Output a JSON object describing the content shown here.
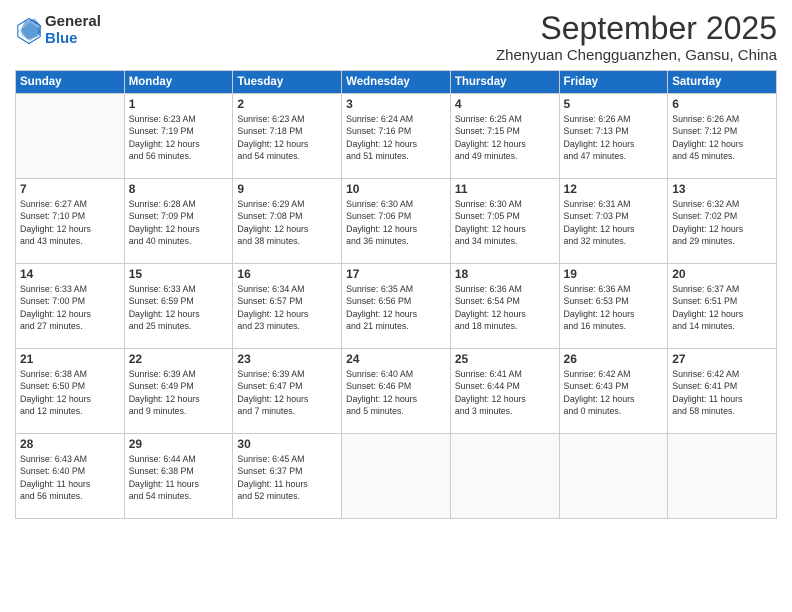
{
  "logo": {
    "general": "General",
    "blue": "Blue"
  },
  "title": "September 2025",
  "location": "Zhenyuan Chengguanzhen, Gansu, China",
  "days_of_week": [
    "Sunday",
    "Monday",
    "Tuesday",
    "Wednesday",
    "Thursday",
    "Friday",
    "Saturday"
  ],
  "weeks": [
    [
      {
        "day": "",
        "info": ""
      },
      {
        "day": "1",
        "info": "Sunrise: 6:23 AM\nSunset: 7:19 PM\nDaylight: 12 hours\nand 56 minutes."
      },
      {
        "day": "2",
        "info": "Sunrise: 6:23 AM\nSunset: 7:18 PM\nDaylight: 12 hours\nand 54 minutes."
      },
      {
        "day": "3",
        "info": "Sunrise: 6:24 AM\nSunset: 7:16 PM\nDaylight: 12 hours\nand 51 minutes."
      },
      {
        "day": "4",
        "info": "Sunrise: 6:25 AM\nSunset: 7:15 PM\nDaylight: 12 hours\nand 49 minutes."
      },
      {
        "day": "5",
        "info": "Sunrise: 6:26 AM\nSunset: 7:13 PM\nDaylight: 12 hours\nand 47 minutes."
      },
      {
        "day": "6",
        "info": "Sunrise: 6:26 AM\nSunset: 7:12 PM\nDaylight: 12 hours\nand 45 minutes."
      }
    ],
    [
      {
        "day": "7",
        "info": "Sunrise: 6:27 AM\nSunset: 7:10 PM\nDaylight: 12 hours\nand 43 minutes."
      },
      {
        "day": "8",
        "info": "Sunrise: 6:28 AM\nSunset: 7:09 PM\nDaylight: 12 hours\nand 40 minutes."
      },
      {
        "day": "9",
        "info": "Sunrise: 6:29 AM\nSunset: 7:08 PM\nDaylight: 12 hours\nand 38 minutes."
      },
      {
        "day": "10",
        "info": "Sunrise: 6:30 AM\nSunset: 7:06 PM\nDaylight: 12 hours\nand 36 minutes."
      },
      {
        "day": "11",
        "info": "Sunrise: 6:30 AM\nSunset: 7:05 PM\nDaylight: 12 hours\nand 34 minutes."
      },
      {
        "day": "12",
        "info": "Sunrise: 6:31 AM\nSunset: 7:03 PM\nDaylight: 12 hours\nand 32 minutes."
      },
      {
        "day": "13",
        "info": "Sunrise: 6:32 AM\nSunset: 7:02 PM\nDaylight: 12 hours\nand 29 minutes."
      }
    ],
    [
      {
        "day": "14",
        "info": "Sunrise: 6:33 AM\nSunset: 7:00 PM\nDaylight: 12 hours\nand 27 minutes."
      },
      {
        "day": "15",
        "info": "Sunrise: 6:33 AM\nSunset: 6:59 PM\nDaylight: 12 hours\nand 25 minutes."
      },
      {
        "day": "16",
        "info": "Sunrise: 6:34 AM\nSunset: 6:57 PM\nDaylight: 12 hours\nand 23 minutes."
      },
      {
        "day": "17",
        "info": "Sunrise: 6:35 AM\nSunset: 6:56 PM\nDaylight: 12 hours\nand 21 minutes."
      },
      {
        "day": "18",
        "info": "Sunrise: 6:36 AM\nSunset: 6:54 PM\nDaylight: 12 hours\nand 18 minutes."
      },
      {
        "day": "19",
        "info": "Sunrise: 6:36 AM\nSunset: 6:53 PM\nDaylight: 12 hours\nand 16 minutes."
      },
      {
        "day": "20",
        "info": "Sunrise: 6:37 AM\nSunset: 6:51 PM\nDaylight: 12 hours\nand 14 minutes."
      }
    ],
    [
      {
        "day": "21",
        "info": "Sunrise: 6:38 AM\nSunset: 6:50 PM\nDaylight: 12 hours\nand 12 minutes."
      },
      {
        "day": "22",
        "info": "Sunrise: 6:39 AM\nSunset: 6:49 PM\nDaylight: 12 hours\nand 9 minutes."
      },
      {
        "day": "23",
        "info": "Sunrise: 6:39 AM\nSunset: 6:47 PM\nDaylight: 12 hours\nand 7 minutes."
      },
      {
        "day": "24",
        "info": "Sunrise: 6:40 AM\nSunset: 6:46 PM\nDaylight: 12 hours\nand 5 minutes."
      },
      {
        "day": "25",
        "info": "Sunrise: 6:41 AM\nSunset: 6:44 PM\nDaylight: 12 hours\nand 3 minutes."
      },
      {
        "day": "26",
        "info": "Sunrise: 6:42 AM\nSunset: 6:43 PM\nDaylight: 12 hours\nand 0 minutes."
      },
      {
        "day": "27",
        "info": "Sunrise: 6:42 AM\nSunset: 6:41 PM\nDaylight: 11 hours\nand 58 minutes."
      }
    ],
    [
      {
        "day": "28",
        "info": "Sunrise: 6:43 AM\nSunset: 6:40 PM\nDaylight: 11 hours\nand 56 minutes."
      },
      {
        "day": "29",
        "info": "Sunrise: 6:44 AM\nSunset: 6:38 PM\nDaylight: 11 hours\nand 54 minutes."
      },
      {
        "day": "30",
        "info": "Sunrise: 6:45 AM\nSunset: 6:37 PM\nDaylight: 11 hours\nand 52 minutes."
      },
      {
        "day": "",
        "info": ""
      },
      {
        "day": "",
        "info": ""
      },
      {
        "day": "",
        "info": ""
      },
      {
        "day": "",
        "info": ""
      }
    ]
  ]
}
